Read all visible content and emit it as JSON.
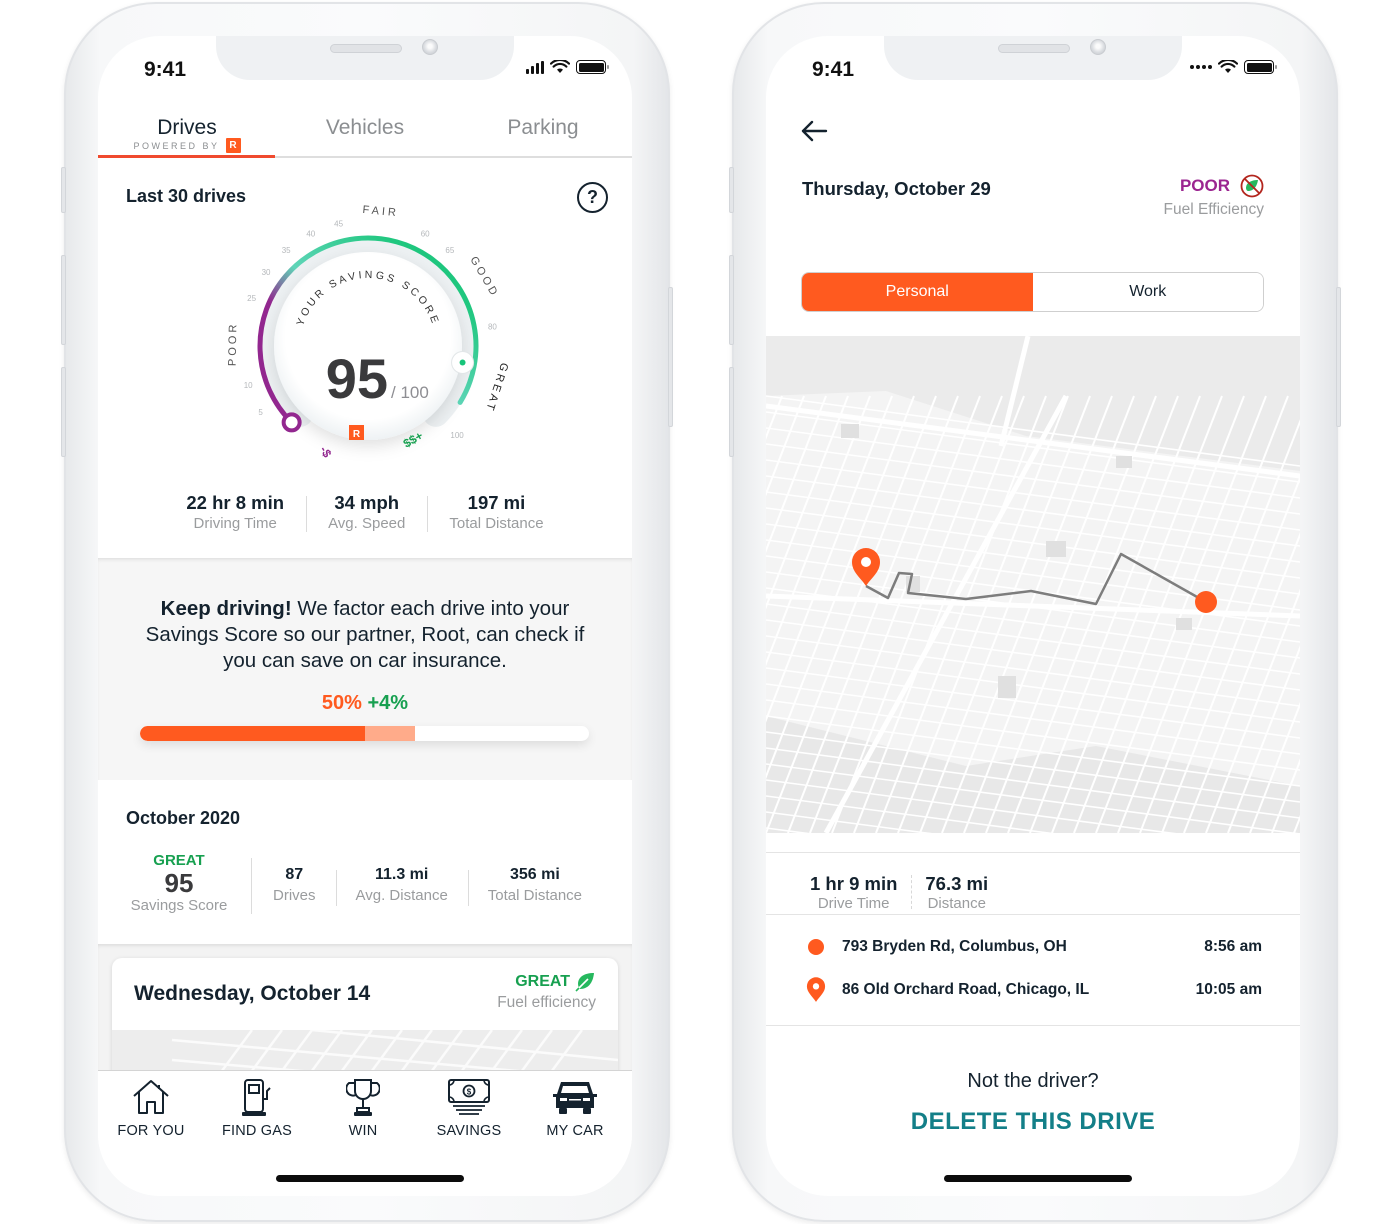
{
  "status_bar": {
    "time": "9:41"
  },
  "drives_screen": {
    "tabs": [
      {
        "label": "Drives",
        "active": true,
        "sublabel": "POWERED BY",
        "badge": "R"
      },
      {
        "label": "Vehicles",
        "active": false
      },
      {
        "label": "Parking",
        "active": false
      }
    ],
    "section_title": "Last 30 drives",
    "help_icon": "?",
    "gauge": {
      "title": "YOUR SAVINGS SCORE",
      "score": 95,
      "score_display": "95",
      "max_display": "/ 100",
      "max": 100,
      "badge": "R",
      "zone_labels": {
        "poor": "POOR",
        "fair": "FAIR",
        "good": "GOOD",
        "great": "GREAT"
      },
      "end_labels": {
        "low": "-$",
        "high": "$$+"
      },
      "ticks": [
        "5",
        "10",
        "25",
        "30",
        "35",
        "40",
        "45",
        "60",
        "65",
        "80",
        "100"
      ],
      "colors": {
        "poor": "#92278f",
        "fair": "#5fd5b8",
        "great": "#17c47a"
      }
    },
    "summary_stats": [
      {
        "value": "22 hr 8 min",
        "label": "Driving Time"
      },
      {
        "value": "34 mph",
        "label": "Avg. Speed"
      },
      {
        "value": "197 mi",
        "label": "Total Distance"
      }
    ],
    "promo": {
      "bold": "Keep driving!",
      "text": " We factor each drive into your Savings Score so our partner, Root, can check if you can save on car insurance.",
      "progress_label": "50%",
      "progress_delta_label": "+4%",
      "progress_percent": 50,
      "progress_delta_percent": 4
    },
    "month": {
      "title": "October 2020",
      "rating": "GREAT",
      "score": "95",
      "score_label": "Savings Score",
      "stats": [
        {
          "value": "87",
          "label": "Drives"
        },
        {
          "value": "11.3 mi",
          "label": "Avg. Distance"
        },
        {
          "value": "356 mi",
          "label": "Total Distance"
        }
      ]
    },
    "drive_card": {
      "date": "Wednesday, October 14",
      "rating": "GREAT",
      "rating_label": "Fuel efficiency",
      "icon": "leaf-icon"
    },
    "bottom_nav": [
      {
        "label": "FOR YOU",
        "icon": "home-icon"
      },
      {
        "label": "FIND GAS",
        "icon": "gas-pump-icon"
      },
      {
        "label": "WIN",
        "icon": "trophy-icon"
      },
      {
        "label": "SAVINGS",
        "icon": "money-icon"
      },
      {
        "label": "MY CAR",
        "icon": "car-icon"
      }
    ]
  },
  "trip_screen": {
    "date": "Thursday, October 29",
    "rating": "POOR",
    "rating_label": "Fuel Efficiency",
    "rating_color": "#9b2590",
    "segments": [
      {
        "label": "Personal",
        "active": true
      },
      {
        "label": "Work",
        "active": false
      }
    ],
    "stats": [
      {
        "value": "1 hr 9 min",
        "label": "Drive Time"
      },
      {
        "value": "76.3 mi",
        "label": "Distance"
      }
    ],
    "stops": [
      {
        "address": "793 Bryden Rd, Columbus, OH",
        "time": "8:56 am",
        "icon": "start-dot-icon"
      },
      {
        "address": "86 Old Orchard Road, Chicago, IL",
        "time": "10:05 am",
        "icon": "destination-pin-icon"
      }
    ],
    "not_driver": "Not the driver?",
    "delete_label": "DELETE THIS DRIVE"
  },
  "colors": {
    "brand_orange": "#ff5a1f",
    "great_green": "#17a050",
    "poor_purple": "#9b2590",
    "teal": "#137f88"
  }
}
